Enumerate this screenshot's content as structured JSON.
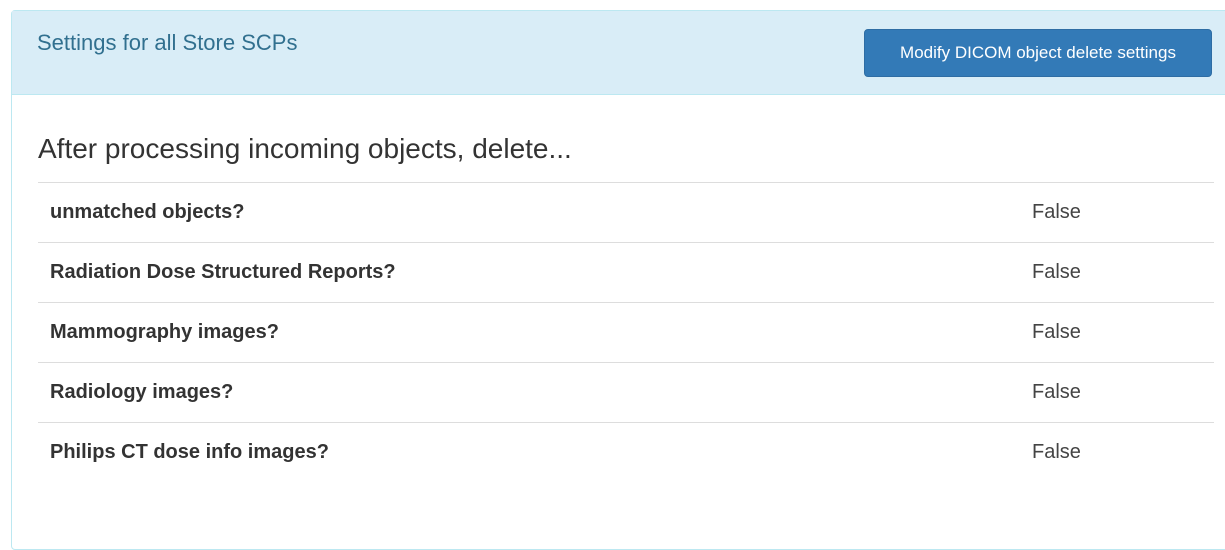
{
  "panel": {
    "title": "Settings for all Store SCPs",
    "modify_button_label": "Modify DICOM object delete settings"
  },
  "section": {
    "title": "After processing incoming objects, delete..."
  },
  "settings": [
    {
      "label": "unmatched objects?",
      "value": "False"
    },
    {
      "label": "Radiation Dose Structured Reports?",
      "value": "False"
    },
    {
      "label": "Mammography images?",
      "value": "False"
    },
    {
      "label": "Radiology images?",
      "value": "False"
    },
    {
      "label": "Philips CT dose info images?",
      "value": "False"
    }
  ],
  "colors": {
    "heading_bg": "#d9edf7",
    "heading_text": "#31708f",
    "button_bg": "#337ab7"
  }
}
